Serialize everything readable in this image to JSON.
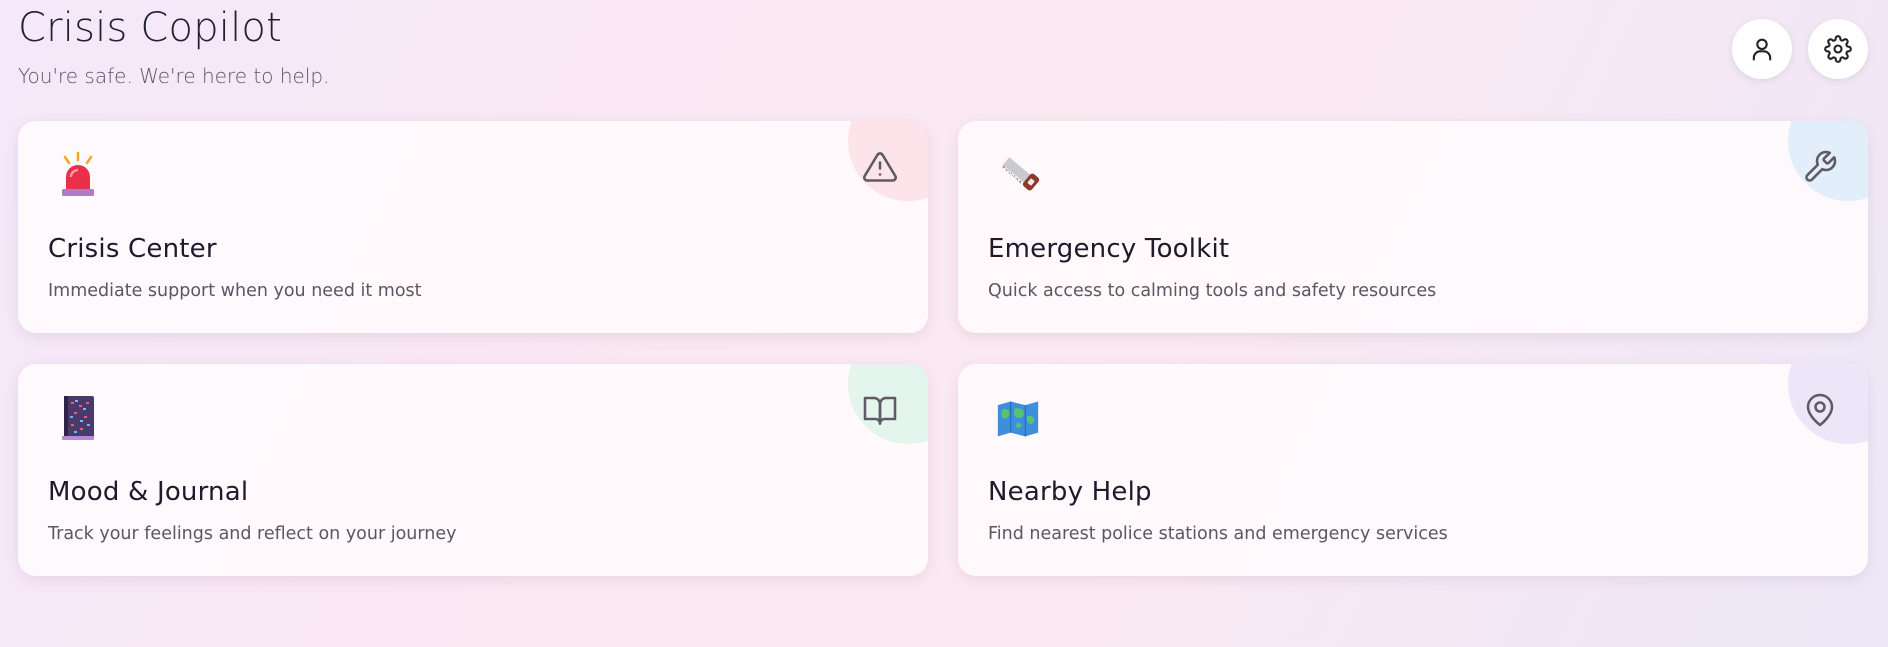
{
  "header": {
    "title": "Crisis Copilot",
    "subtitle": "You're safe. We're here to help."
  },
  "actions": {
    "profile_icon": "user-icon",
    "settings_icon": "gear-icon"
  },
  "cards": [
    {
      "id": "crisis-center",
      "title": "Crisis Center",
      "description": "Immediate support when you need it most",
      "emoji": "police-light",
      "corner_icon": "warning-triangle-icon",
      "accent": "#fde4ec"
    },
    {
      "id": "emergency-toolkit",
      "title": "Emergency Toolkit",
      "description": "Quick access to calming tools and safety resources",
      "emoji": "saw",
      "corner_icon": "wrench-icon",
      "accent": "#e3eefa"
    },
    {
      "id": "mood-journal",
      "title": "Mood & Journal",
      "description": "Track your feelings and reflect on your journey",
      "emoji": "notebook",
      "corner_icon": "open-book-icon",
      "accent": "#e6f6ef"
    },
    {
      "id": "nearby-help",
      "title": "Nearby Help",
      "description": "Find nearest police stations and emergency services",
      "emoji": "world-map",
      "corner_icon": "map-pin-icon",
      "accent": "#efe8fa"
    }
  ]
}
